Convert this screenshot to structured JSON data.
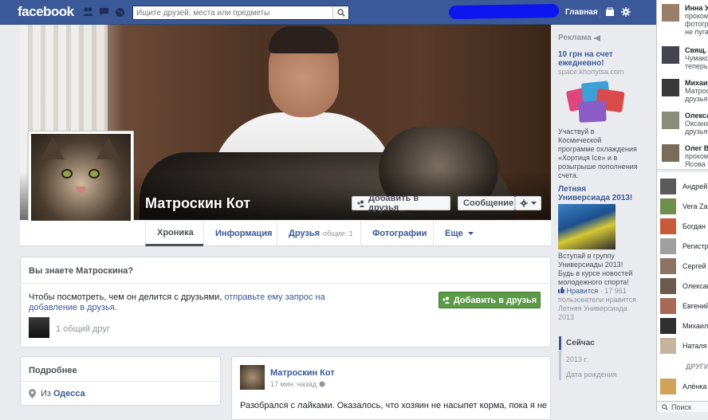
{
  "topbar": {
    "logo": "facebook",
    "search_placeholder": "Ищите друзей, места или предметы",
    "home": "Главная"
  },
  "profile": {
    "name": "Матроскин Кот",
    "add_friend": "Добавить в друзья",
    "message": "Сообщение"
  },
  "tabs": [
    {
      "label": "Хроника"
    },
    {
      "label": "Информация"
    },
    {
      "label": "Друзья",
      "sub": "общие: 1"
    },
    {
      "label": "Фотографии"
    },
    {
      "label": "Еще"
    }
  ],
  "know_box": {
    "title": "Вы знаете Матроскина?",
    "text_prefix": "Чтобы посмотреть, чем он делится с друзьями, ",
    "link": "отправьте ему запрос на добавление в друзья",
    "text_suffix": ".",
    "add_button": "Добавить в друзья",
    "mutual": "1 общий друг"
  },
  "about": {
    "title": "Подробнее",
    "from_prefix": "Из ",
    "city": "Одесса"
  },
  "post": {
    "author": "Матроскин Кот",
    "time": "17 мин. назад",
    "text": "Разобрался с лайками. Оказалось, что хозяин не насыпет корма, пока я не"
  },
  "ads": {
    "header": "Реклама",
    "ad1": {
      "title": "10 грн на счет ежедневно!",
      "domain": "space.khortytsa.com",
      "body": "Участвуй в Космической программе охлаждения «Хортиця Ice» и в розыгрыше пополнения счета."
    },
    "ad2": {
      "title": "Летняя Универсиада 2013!",
      "body": "Вступай в группу Универсиады 2013! Будь в курсе новостей молодежного спорта!",
      "like": "Нравится",
      "likes_count": "· 17 961",
      "likes_text": "пользователи нравится Летняя Универсиада 2013"
    }
  },
  "timeline_nav": {
    "current": "Сейчас",
    "year": "2013 г.",
    "birth": "Дата рождения"
  },
  "chat": {
    "tickers": [
      {
        "name": "Инна У",
        "lines": [
          "прокомм",
          "фотогра",
          "не пугае"
        ]
      },
      {
        "name": "Свящ. С",
        "lines": [
          "Чумако",
          "теперь д"
        ]
      },
      {
        "name": "Михаил",
        "lines": [
          "Матрос",
          "друзья."
        ]
      },
      {
        "name": "Олекса",
        "lines": [
          "Оксана",
          "друзья."
        ]
      },
      {
        "name": "Олег Ве",
        "lines": [
          "прокомм",
          "Ясова К"
        ]
      }
    ],
    "friends": [
      "Андрей",
      "Vera Zap",
      "Богдан С",
      "Регистр",
      "Сергей Д",
      "Олексан",
      "Евгений",
      "Михаил",
      "Наталя"
    ],
    "more_label": "ДРУГИ",
    "more_friends": [
      "Алёнка д"
    ],
    "search": "Поиск"
  },
  "colors": {
    "brand": "#3b5998",
    "green_button": "#5b9a47"
  }
}
